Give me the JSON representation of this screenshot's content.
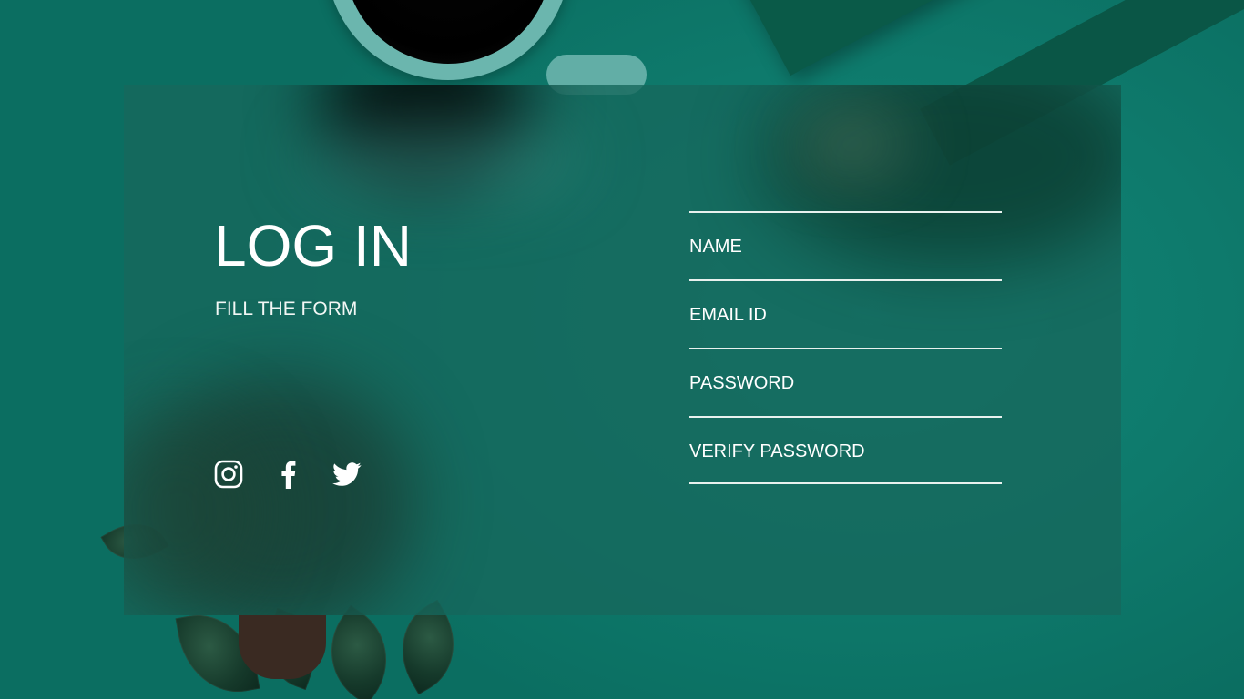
{
  "login": {
    "title": "LOG IN",
    "subtitle": "FILL THE FORM"
  },
  "social": {
    "icons": [
      "instagram-icon",
      "facebook-icon",
      "twitter-icon"
    ]
  },
  "form": {
    "name_placeholder": "NAME",
    "email_placeholder": "EMAIL ID",
    "password_placeholder": "PASSWORD",
    "verify_password_placeholder": "VERIFY PASSWORD"
  },
  "colors": {
    "background": "#0e7a6c",
    "card": "#16685c",
    "text": "#ffffff"
  }
}
